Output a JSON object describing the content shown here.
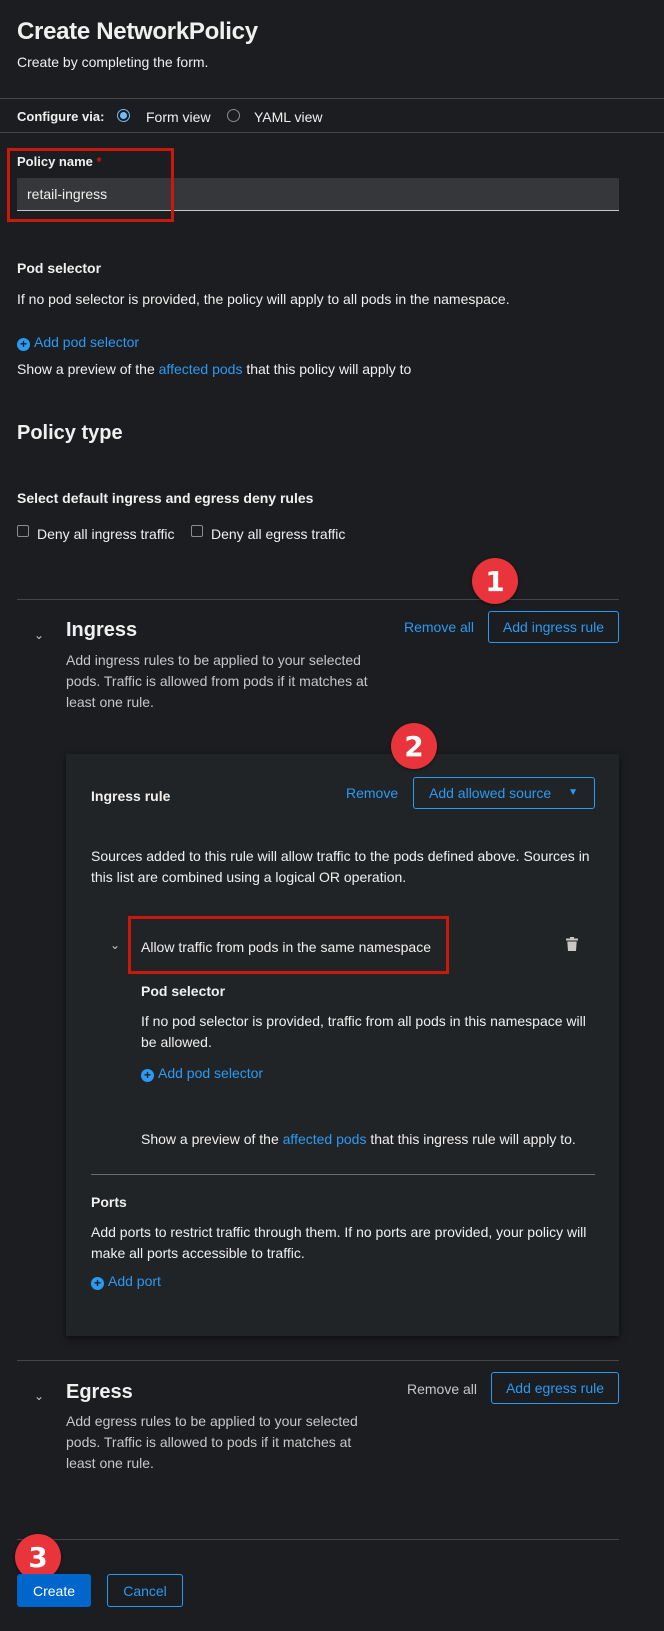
{
  "header": {
    "title": "Create NetworkPolicy",
    "subtitle": "Create by completing the form."
  },
  "configure": {
    "label": "Configure via:",
    "options": [
      {
        "label": "Form view",
        "selected": true
      },
      {
        "label": "YAML view",
        "selected": false
      }
    ]
  },
  "policy_name": {
    "label": "Policy name",
    "required_mark": "*",
    "value": "retail-ingress"
  },
  "pod_selector": {
    "heading": "Pod selector",
    "help": "If no pod selector is provided, the policy will apply to all pods in the namespace.",
    "add_link": "Add pod selector",
    "preview_prefix": "Show a preview of the ",
    "preview_link": "affected pods",
    "preview_suffix": " that this policy will apply to"
  },
  "policy_type": {
    "heading": "Policy type",
    "deny_heading": "Select default ingress and egress deny rules",
    "deny_ingress": "Deny all ingress traffic",
    "deny_egress": "Deny all egress traffic"
  },
  "ingress": {
    "heading": "Ingress",
    "description_lines": [
      "Add ingress rules to be applied to your selected",
      "pods. Traffic is allowed from pods if it matches at",
      "least one rule."
    ],
    "remove_all": "Remove all",
    "add_rule": "Add ingress rule",
    "rule": {
      "heading": "Ingress rule",
      "remove": "Remove",
      "add_source": "Add allowed source",
      "description_lines": [
        "Sources added to this rule will allow traffic to the pods defined above. Sources in",
        "this list are combined using a logical OR operation."
      ],
      "source": {
        "title": "Allow traffic from pods in the same namespace",
        "pod_selector_heading": "Pod selector",
        "help_lines": [
          "If no pod selector is provided, traffic from all pods in this namespace will",
          "be allowed."
        ],
        "add_pod_selector": "Add pod selector",
        "preview_prefix": "Show a preview of the ",
        "preview_link": "affected pods",
        "preview_suffix": " that this ingress rule will apply to."
      },
      "ports": {
        "heading": "Ports",
        "help_lines": [
          "Add ports to restrict traffic through them. If no ports are provided, your policy will",
          "make all ports accessible to traffic."
        ],
        "add_port": "Add port"
      }
    }
  },
  "egress": {
    "heading": "Egress",
    "description_lines": [
      "Add egress rules to be applied to your selected",
      "pods. Traffic is allowed to pods if it matches at",
      "least one rule."
    ],
    "remove_all": "Remove all",
    "add_rule": "Add egress rule"
  },
  "footer": {
    "create": "Create",
    "cancel": "Cancel"
  },
  "annotations": {
    "badges": [
      "1",
      "2",
      "3"
    ],
    "badge_color": "#e8343a",
    "highlight_color": "#c9190b"
  },
  "colors": {
    "background": "#1b1d21",
    "card": "#212427",
    "link": "#2b9af3",
    "primary": "#0066cc"
  }
}
